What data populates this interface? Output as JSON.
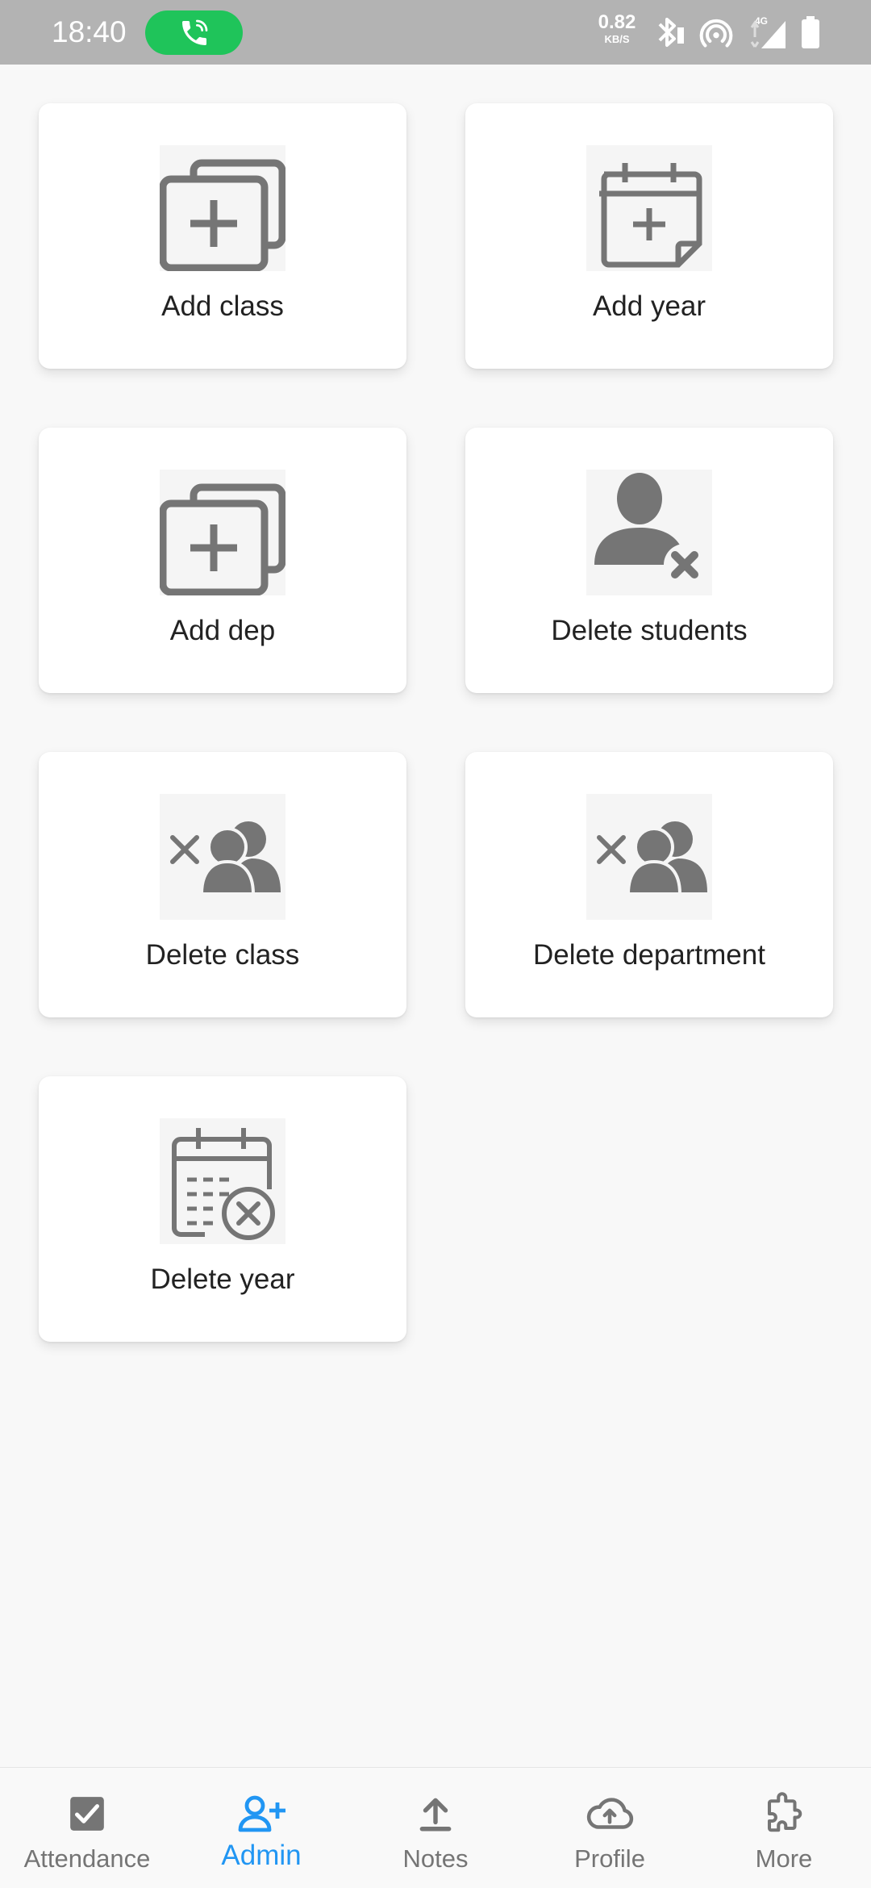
{
  "status_bar": {
    "time": "18:40",
    "call_indicator": "phone-call-icon",
    "net_speed_value": "0.82",
    "net_speed_unit": "KB/S",
    "network_type": "4G",
    "icons": [
      "bluetooth-icon",
      "hotspot-icon",
      "signal-icon",
      "battery-icon"
    ]
  },
  "cards": [
    {
      "label": "Add class",
      "icon": "add-stack-icon"
    },
    {
      "label": "Add year",
      "icon": "calendar-add-icon"
    },
    {
      "label": "Add dep",
      "icon": "add-stack-icon"
    },
    {
      "label": "Delete students",
      "icon": "user-remove-icon"
    },
    {
      "label": "Delete class",
      "icon": "group-remove-icon"
    },
    {
      "label": "Delete department",
      "icon": "group-remove-icon"
    },
    {
      "label": "Delete year",
      "icon": "calendar-delete-icon"
    }
  ],
  "bottom_nav": {
    "active": "Admin",
    "items": [
      {
        "label": "Attendance",
        "icon": "checkbox-icon"
      },
      {
        "label": "Admin",
        "icon": "person-add-icon"
      },
      {
        "label": "Notes",
        "icon": "upload-icon"
      },
      {
        "label": "Profile",
        "icon": "cloud-upload-icon"
      },
      {
        "label": "More",
        "icon": "puzzle-icon"
      }
    ]
  },
  "colors": {
    "status_bar": "#b3b3b3",
    "call_pill": "#1fc45a",
    "background": "#f8f8f8",
    "card": "#ffffff",
    "icon_gray": "#757575",
    "active_accent": "#2196f3",
    "inactive_nav": "#757575"
  }
}
